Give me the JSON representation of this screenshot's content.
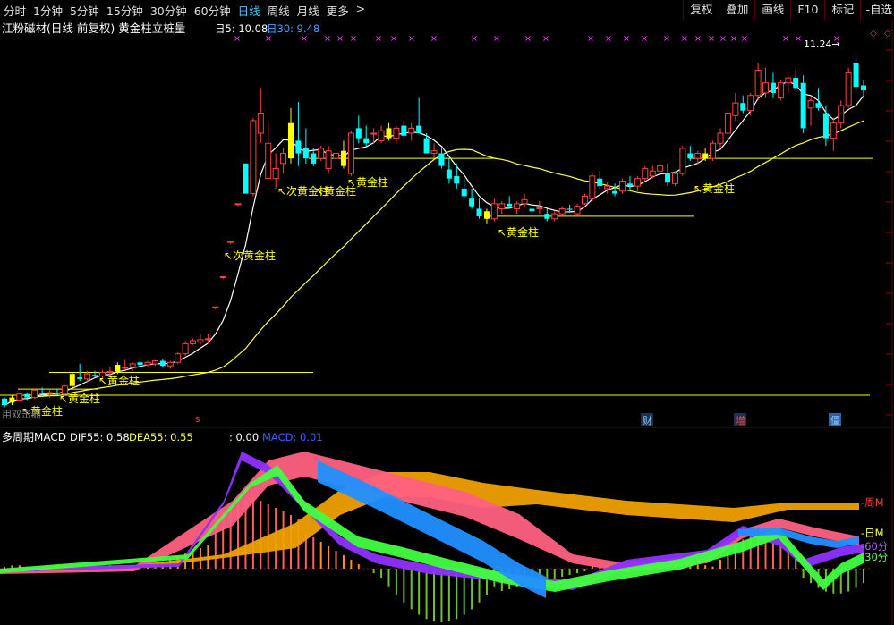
{
  "toolbar": {
    "periods": [
      "分时",
      "1分钟",
      "5分钟",
      "15分钟",
      "30分钟",
      "60分钟",
      "日线",
      "周线",
      "月线",
      "更多"
    ],
    "active_period": "日线",
    "more_arrow": ">",
    "right_buttons": [
      "复权",
      "叠加",
      "画线",
      "F10",
      "标记",
      "-自选"
    ]
  },
  "colors": {
    "up": "#ff4040",
    "down": "#00ffff",
    "golden": "#ffff00",
    "ma_short": "#ffffff",
    "ma_long": "#ffff40",
    "weekly": "#f0a000",
    "daily": "#ff6080",
    "min60": "#9030ff",
    "min30": "#40ff40",
    "blue_band": "#2090ff",
    "bg": "#000000",
    "grid": "#5a0000"
  },
  "header": {
    "stock_title": "江粉磁材(日线 前复权) 黄金柱立桩量",
    "day_label": "日5: 10.08",
    "day30_label": "日30: 9.48"
  },
  "markers": {
    "x_mark": "×",
    "high_label": "11.24",
    "left_overlay": "用双击删",
    "red_marker": "s",
    "badges": [
      "财",
      "增",
      "僵"
    ]
  },
  "macd_header": {
    "name": "多周期MACD",
    "dif": "DIF55: 0.58",
    "dea": "DEA55: 0.55",
    "third": ": 0.00",
    "macd": "MACD: 0.01"
  },
  "macd_labels": {
    "weekly": "周M",
    "daily": "日M",
    "min60": "60分",
    "min30": "30分"
  },
  "chart_data": {
    "type": "candlestick",
    "y_range": [
      4.0,
      11.6
    ],
    "candles": [
      [
        4.43,
        4.45,
        4.25,
        4.3
      ],
      [
        4.35,
        4.5,
        4.3,
        4.45
      ],
      [
        4.4,
        4.55,
        4.38,
        4.52
      ],
      [
        4.52,
        4.55,
        4.4,
        4.45
      ],
      [
        4.45,
        4.62,
        4.42,
        4.6
      ],
      [
        4.55,
        4.65,
        4.48,
        4.52
      ],
      [
        4.55,
        4.6,
        4.45,
        4.55
      ],
      [
        4.55,
        4.62,
        4.5,
        4.52
      ],
      [
        4.52,
        4.7,
        4.5,
        4.68
      ],
      [
        4.68,
        4.95,
        4.62,
        4.92
      ],
      [
        4.85,
        5.12,
        4.78,
        4.82
      ],
      [
        4.82,
        4.98,
        4.75,
        4.92
      ],
      [
        4.9,
        4.98,
        4.85,
        4.88
      ],
      [
        4.88,
        5.0,
        4.82,
        4.95
      ],
      [
        4.95,
        5.05,
        4.9,
        4.97
      ],
      [
        4.97,
        5.15,
        4.92,
        5.1
      ],
      [
        5.05,
        5.2,
        5.0,
        5.05
      ],
      [
        5.05,
        5.15,
        4.98,
        5.12
      ],
      [
        5.15,
        5.22,
        5.05,
        5.1
      ],
      [
        5.1,
        5.18,
        5.05,
        5.15
      ],
      [
        5.12,
        5.2,
        5.08,
        5.18
      ],
      [
        5.18,
        5.22,
        5.05,
        5.08
      ],
      [
        5.08,
        5.18,
        5.02,
        5.15
      ],
      [
        5.15,
        5.35,
        5.12,
        5.32
      ],
      [
        5.32,
        5.58,
        5.28,
        5.52
      ],
      [
        5.52,
        5.62,
        5.5,
        5.58
      ],
      [
        5.55,
        5.72,
        5.5,
        5.6
      ],
      [
        5.6,
        5.72,
        5.52,
        5.62
      ],
      [
        6.25,
        6.25,
        6.2,
        6.25
      ],
      [
        6.85,
        6.85,
        6.8,
        6.85
      ],
      [
        7.55,
        7.55,
        7.5,
        7.55
      ],
      [
        8.3,
        8.3,
        8.25,
        8.3
      ],
      [
        9.1,
        9.1,
        8.5,
        8.5
      ],
      [
        8.5,
        10.0,
        8.45,
        9.95
      ],
      [
        9.7,
        10.6,
        9.5,
        10.1
      ],
      [
        8.8,
        9.9,
        8.8,
        9.5
      ],
      [
        8.8,
        9.3,
        8.6,
        9.0
      ],
      [
        9.1,
        9.4,
        8.9,
        9.3
      ],
      [
        9.2,
        10.2,
        9.1,
        9.9
      ],
      [
        9.55,
        10.32,
        9.05,
        9.3
      ],
      [
        9.4,
        9.8,
        9.1,
        9.2
      ],
      [
        9.3,
        9.4,
        9.05,
        9.1
      ],
      [
        9.2,
        9.45,
        9.15,
        9.4
      ],
      [
        9.0,
        9.45,
        8.9,
        9.35
      ],
      [
        9.2,
        9.45,
        9.1,
        9.3
      ],
      [
        9.35,
        9.55,
        9.0,
        9.05
      ],
      [
        8.9,
        9.75,
        8.85,
        9.7
      ],
      [
        9.8,
        10.05,
        9.5,
        9.6
      ],
      [
        9.6,
        9.85,
        9.45,
        9.5
      ],
      [
        9.7,
        9.8,
        9.5,
        9.7
      ],
      [
        9.55,
        9.85,
        9.5,
        9.75
      ],
      [
        9.8,
        9.9,
        9.55,
        9.6
      ],
      [
        9.6,
        9.85,
        9.5,
        9.8
      ],
      [
        9.85,
        9.95,
        9.6,
        9.65
      ],
      [
        9.7,
        9.9,
        9.55,
        9.8
      ],
      [
        9.85,
        10.4,
        9.7,
        9.7
      ],
      [
        9.6,
        9.7,
        9.3,
        9.3
      ],
      [
        9.3,
        9.5,
        9.2,
        9.35
      ],
      [
        9.3,
        9.4,
        9.0,
        9.05
      ],
      [
        8.98,
        9.2,
        8.7,
        8.8
      ],
      [
        8.85,
        9.1,
        8.6,
        8.7
      ],
      [
        8.6,
        8.8,
        8.4,
        8.45
      ],
      [
        8.4,
        8.6,
        8.2,
        8.25
      ],
      [
        8.2,
        8.4,
        8.0,
        8.05
      ],
      [
        8.0,
        8.2,
        7.9,
        8.15
      ],
      [
        8.0,
        8.4,
        7.95,
        8.3
      ],
      [
        8.2,
        8.35,
        8.1,
        8.3
      ],
      [
        8.3,
        8.45,
        8.2,
        8.25
      ],
      [
        8.2,
        8.35,
        8.1,
        8.3
      ],
      [
        8.3,
        8.5,
        8.22,
        8.38
      ],
      [
        8.2,
        8.3,
        8.1,
        8.15
      ],
      [
        8.2,
        8.35,
        8.1,
        8.22
      ],
      [
        8.1,
        8.2,
        7.95,
        8.0
      ],
      [
        8.0,
        8.15,
        7.95,
        8.1
      ],
      [
        8.1,
        8.25,
        8.05,
        8.2
      ],
      [
        8.2,
        8.28,
        8.12,
        8.18
      ],
      [
        8.1,
        8.3,
        8.05,
        8.25
      ],
      [
        8.3,
        8.5,
        8.28,
        8.45
      ],
      [
        8.4,
        8.9,
        8.35,
        8.85
      ],
      [
        8.8,
        8.95,
        8.6,
        8.65
      ],
      [
        8.6,
        8.72,
        8.5,
        8.65
      ],
      [
        8.55,
        8.7,
        8.45,
        8.5
      ],
      [
        8.55,
        8.8,
        8.5,
        8.75
      ],
      [
        8.7,
        8.85,
        8.55,
        8.65
      ],
      [
        8.65,
        8.85,
        8.55,
        8.8
      ],
      [
        8.8,
        9.05,
        8.75,
        9.0
      ],
      [
        8.85,
        9.05,
        8.8,
        8.95
      ],
      [
        8.95,
        9.15,
        8.85,
        9.05
      ],
      [
        8.9,
        9.1,
        8.65,
        8.72
      ],
      [
        8.7,
        8.95,
        8.65,
        8.9
      ],
      [
        8.9,
        9.45,
        8.85,
        9.4
      ],
      [
        9.3,
        9.45,
        9.15,
        9.2
      ],
      [
        9.2,
        9.35,
        9.1,
        9.3
      ],
      [
        9.3,
        9.4,
        9.15,
        9.2
      ],
      [
        9.2,
        9.55,
        9.15,
        9.5
      ],
      [
        9.5,
        9.8,
        9.4,
        9.7
      ],
      [
        9.7,
        10.15,
        9.6,
        10.1
      ],
      [
        10.05,
        10.5,
        9.95,
        10.3
      ],
      [
        10.3,
        10.45,
        10.1,
        10.15
      ],
      [
        10.15,
        10.5,
        10.05,
        10.45
      ],
      [
        10.45,
        11.1,
        10.35,
        10.95
      ],
      [
        10.5,
        11.0,
        10.4,
        10.7
      ],
      [
        10.7,
        10.9,
        10.4,
        10.5
      ],
      [
        10.4,
        10.75,
        10.35,
        10.7
      ],
      [
        10.7,
        10.85,
        10.5,
        10.8
      ],
      [
        10.8,
        10.95,
        10.55,
        10.6
      ],
      [
        10.7,
        10.85,
        9.7,
        9.8
      ],
      [
        10.2,
        10.45,
        9.85,
        10.35
      ],
      [
        10.3,
        10.6,
        10.15,
        10.2
      ],
      [
        10.1,
        10.25,
        9.45,
        9.6
      ],
      [
        9.6,
        10.0,
        9.35,
        9.9
      ],
      [
        9.9,
        10.35,
        9.8,
        10.25
      ],
      [
        10.25,
        11.0,
        10.2,
        10.9
      ],
      [
        11.1,
        11.24,
        10.5,
        10.62
      ],
      [
        10.65,
        10.75,
        10.4,
        10.55
      ]
    ]
  }
}
